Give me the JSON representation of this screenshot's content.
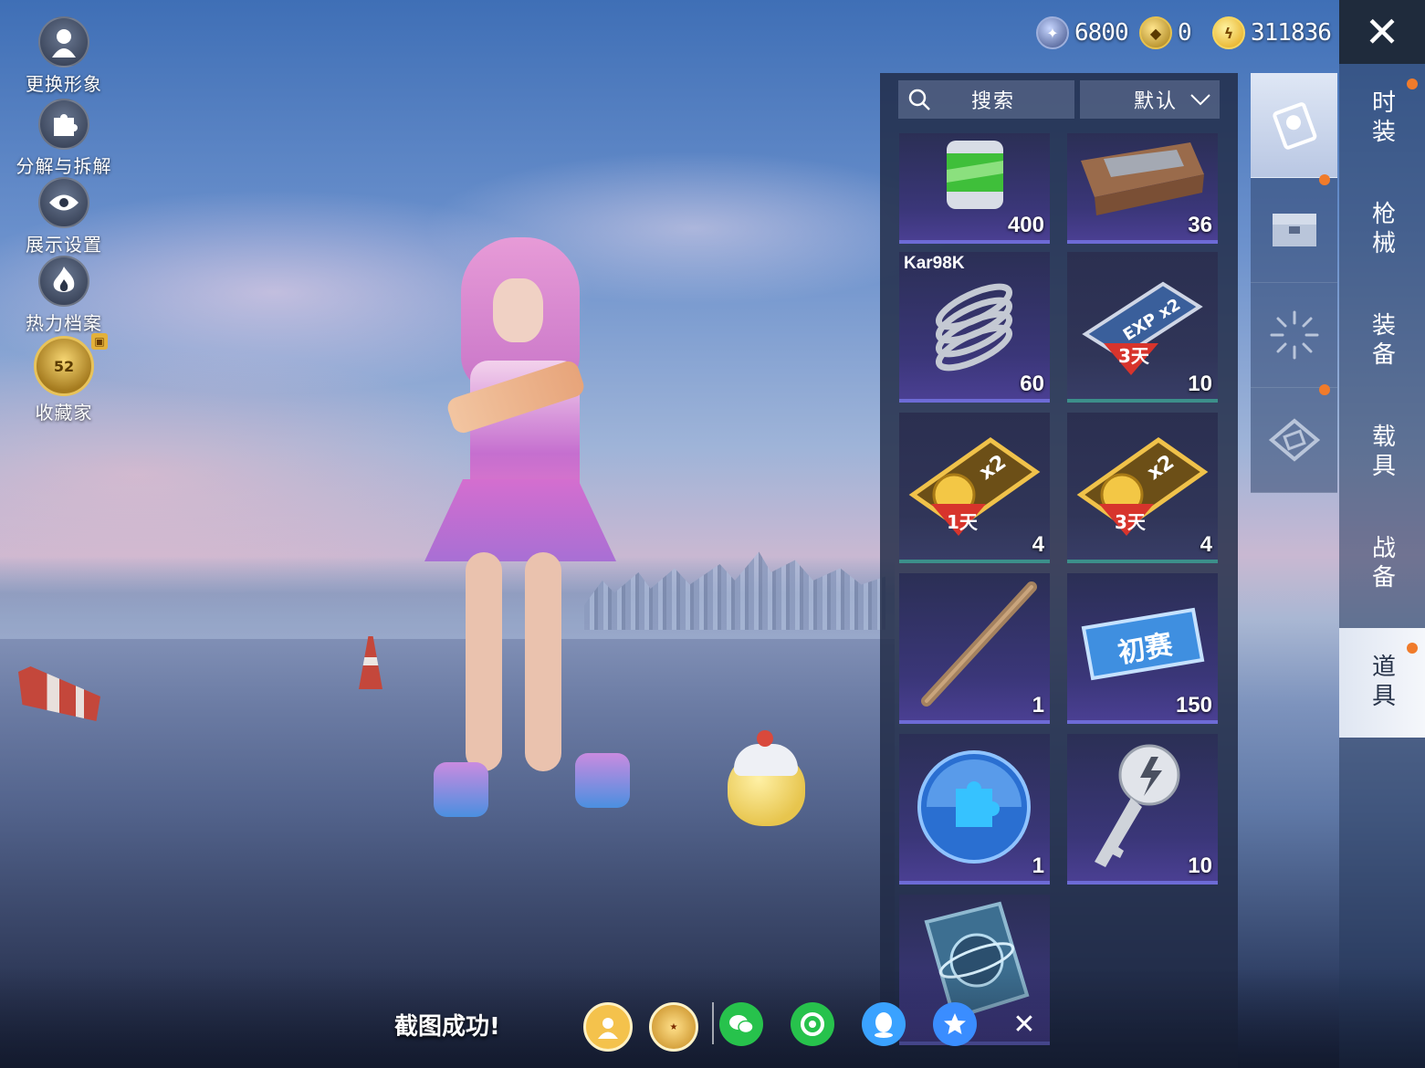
{
  "left_menu": [
    {
      "label": "更换形象",
      "icon": "avatar-icon"
    },
    {
      "label": "分解与拆解",
      "icon": "puzzle-icon"
    },
    {
      "label": "展示设置",
      "icon": "eye-icon"
    },
    {
      "label": "热力档案",
      "icon": "flame-icon"
    },
    {
      "label": "收藏家",
      "icon": "collector-badge-icon",
      "level": "52"
    }
  ],
  "currency": [
    {
      "icon": "silver-coin-icon",
      "value": "6800"
    },
    {
      "icon": "gold-coin-icon",
      "value": "0"
    },
    {
      "icon": "lightning-coin-icon",
      "value": "311836"
    }
  ],
  "close_label": "✕",
  "search": {
    "label": "搜索"
  },
  "sort": {
    "label": "默认"
  },
  "items": [
    {
      "icon": "green-canister-icon",
      "qty": "400",
      "tag": ""
    },
    {
      "icon": "tool-crate-icon",
      "qty": "36",
      "tag": ""
    },
    {
      "icon": "spring-icon",
      "qty": "60",
      "tag": "Kar98K"
    },
    {
      "icon": "exp-card-icon",
      "qty": "10",
      "tag": "",
      "card_text": "EXP x2",
      "days": "3天"
    },
    {
      "icon": "coin-card-icon",
      "qty": "4",
      "tag": "",
      "card_text": "x2",
      "days": "1天"
    },
    {
      "icon": "coin-card-icon",
      "qty": "4",
      "tag": "",
      "card_text": "x2",
      "days": "3天"
    },
    {
      "icon": "wooden-stick-icon",
      "qty": "1",
      "tag": ""
    },
    {
      "icon": "ticket-icon",
      "qty": "150",
      "tag": "",
      "ticket_text": "初赛"
    },
    {
      "icon": "puzzle-orb-icon",
      "qty": "1",
      "tag": ""
    },
    {
      "icon": "lightning-key-icon",
      "qty": "10",
      "tag": ""
    },
    {
      "icon": "planet-card-icon",
      "qty": "",
      "tag": ""
    }
  ],
  "category_icons": [
    "costume-card-icon",
    "chest-icon",
    "firework-icon",
    "ticket-diamond-icon"
  ],
  "side_tabs": [
    {
      "label": "时装",
      "dot": true
    },
    {
      "label": "枪械",
      "dot": false
    },
    {
      "label": "装备",
      "dot": false
    },
    {
      "label": "载具",
      "dot": false
    },
    {
      "label": "战备",
      "dot": false
    },
    {
      "label": "道具",
      "dot": true,
      "active": true
    }
  ],
  "share": {
    "message": "截图成功!",
    "targets": [
      "peace-elite-friend-icon",
      "game-for-peace-logo-icon",
      "wechat-icon",
      "moments-icon",
      "qq-icon",
      "qzone-icon"
    ]
  },
  "colors": {
    "accent_dot": "#f07b2b",
    "tile_border_purple": "#6d6bd6",
    "tile_border_teal": "#3c8f8a"
  }
}
